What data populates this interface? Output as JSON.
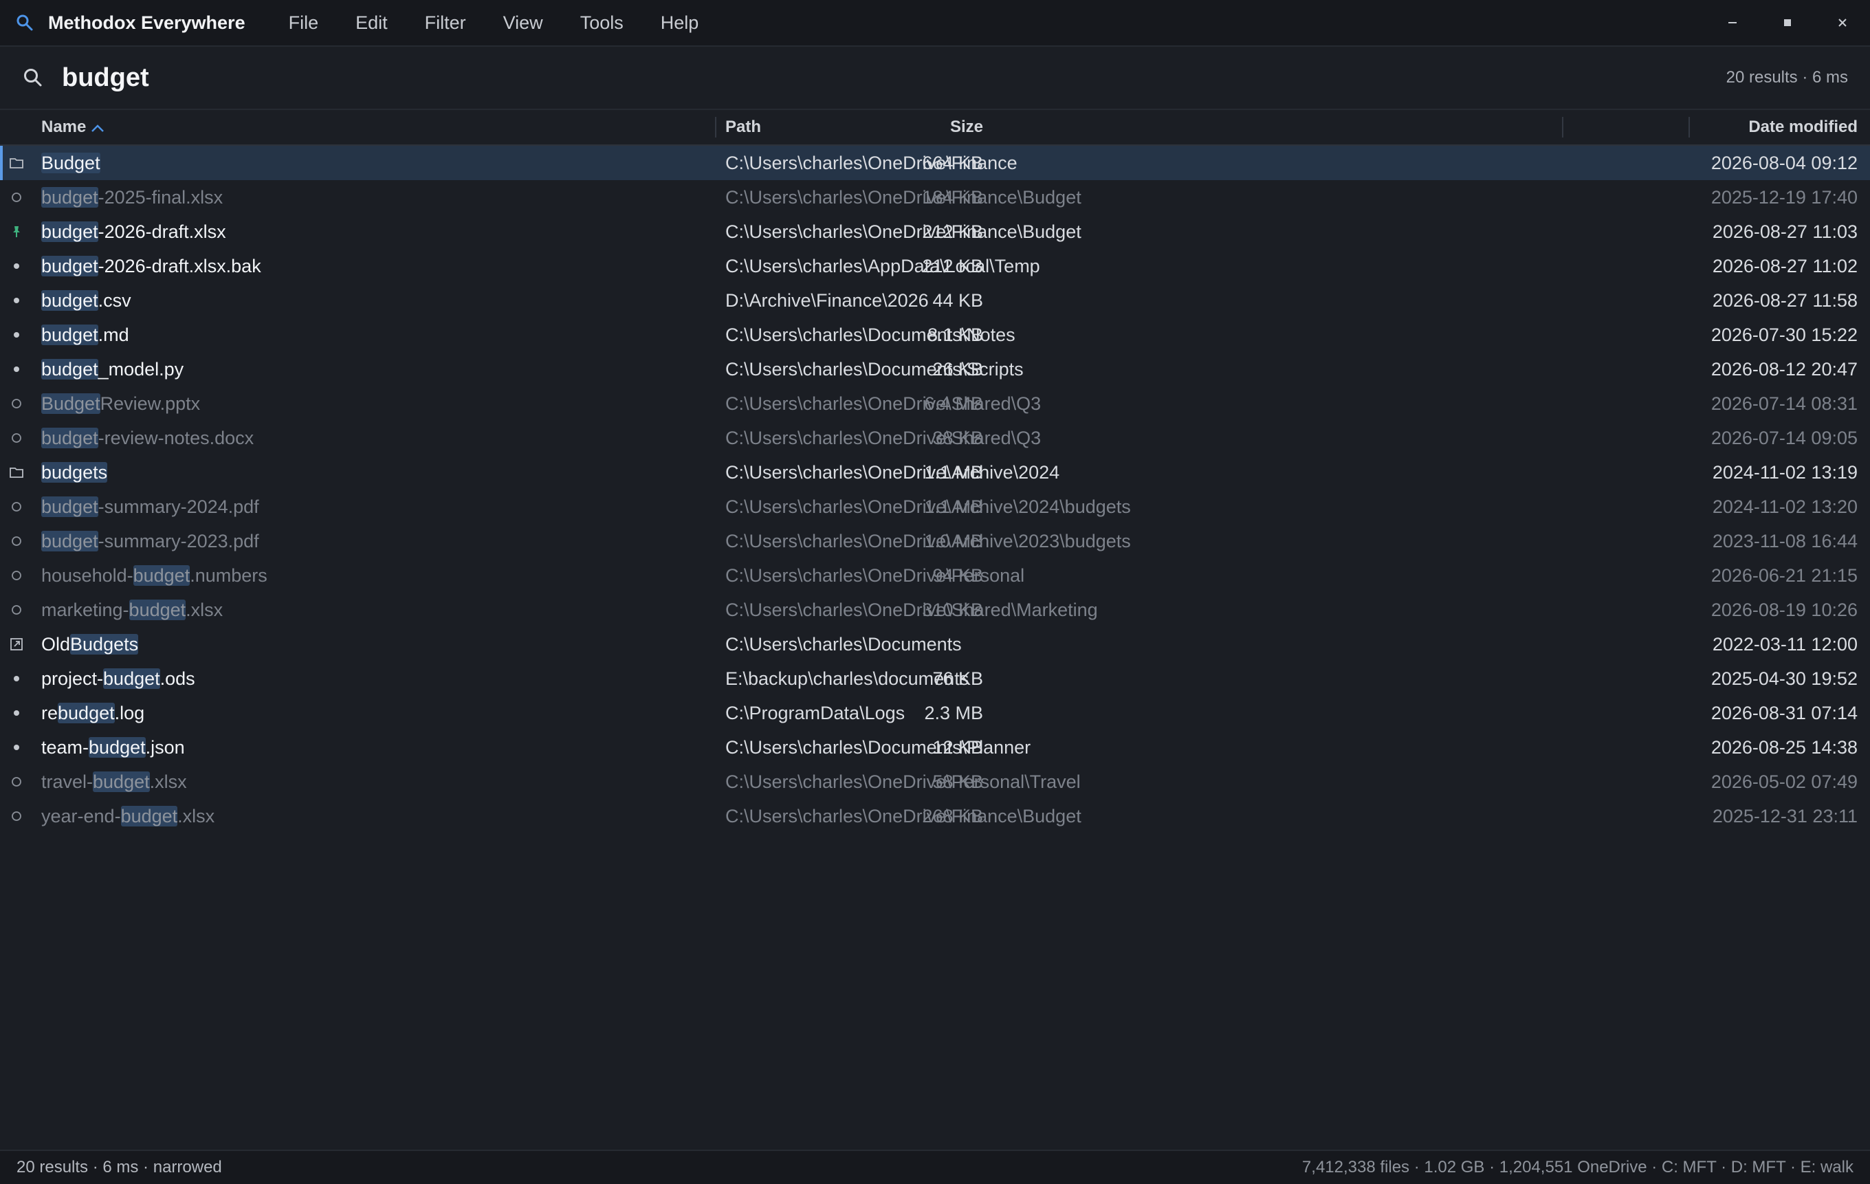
{
  "app": {
    "title": "Methodox Everywhere",
    "menu": [
      "File",
      "Edit",
      "Filter",
      "View",
      "Tools",
      "Help"
    ],
    "accent_color": "#4d94e8"
  },
  "search": {
    "query": "budget",
    "meta": "20 results · 6 ms"
  },
  "columns": {
    "name": "Name",
    "path": "Path",
    "size": "Size",
    "date": "Date modified"
  },
  "rows": [
    {
      "pre": "",
      "hl": "Budget",
      "post": "",
      "path": "C:\\Users\\charles\\OneDrive\\Finance",
      "size": "664 KB",
      "date": "2026-08-04 09:12",
      "icon": "folder-icon",
      "style": "bright",
      "selected": true
    },
    {
      "pre": "",
      "hl": "budget",
      "post": "-2025-final.xlsx",
      "path": "C:\\Users\\charles\\OneDrive\\Finance\\Budget",
      "size": "184 KB",
      "date": "2025-12-19 17:40",
      "icon": "cloud-file-icon",
      "style": "dim"
    },
    {
      "pre": "",
      "hl": "budget",
      "post": "-2026-draft.xlsx",
      "path": "C:\\Users\\charles\\OneDrive\\Finance\\Budget",
      "size": "212 KB",
      "date": "2026-08-27 11:03",
      "icon": "pin-icon",
      "style": "bright"
    },
    {
      "pre": "",
      "hl": "budget",
      "post": "-2026-draft.xlsx.bak",
      "path": "C:\\Users\\charles\\AppData\\Local\\Temp",
      "size": "212 KB",
      "date": "2026-08-27 11:02",
      "icon": "file-dot-icon",
      "style": "bright"
    },
    {
      "pre": "",
      "hl": "budget",
      "post": ".csv",
      "path": "D:\\Archive\\Finance\\2026",
      "size": "44 KB",
      "date": "2026-08-27 11:58",
      "icon": "file-dot-icon",
      "style": "bright"
    },
    {
      "pre": "",
      "hl": "budget",
      "post": ".md",
      "path": "C:\\Users\\charles\\Documents\\Notes",
      "size": "8.1 KB",
      "date": "2026-07-30 15:22",
      "icon": "file-dot-icon",
      "style": "bright"
    },
    {
      "pre": "",
      "hl": "budget",
      "post": "_model.py",
      "path": "C:\\Users\\charles\\Documents\\Scripts",
      "size": "26 KB",
      "date": "2026-08-12 20:47",
      "icon": "file-dot-icon",
      "style": "bright"
    },
    {
      "pre": "",
      "hl": "Budget",
      "post": "Review.pptx",
      "path": "C:\\Users\\charles\\OneDrive\\Shared\\Q3",
      "size": "6.4 MB",
      "date": "2026-07-14 08:31",
      "icon": "cloud-file-icon",
      "style": "dim"
    },
    {
      "pre": "",
      "hl": "budget",
      "post": "-review-notes.docx",
      "path": "C:\\Users\\charles\\OneDrive\\Shared\\Q3",
      "size": "38 KB",
      "date": "2026-07-14 09:05",
      "icon": "cloud-file-icon",
      "style": "dim"
    },
    {
      "pre": "",
      "hl": "budgets",
      "post": "",
      "path": "C:\\Users\\charles\\OneDrive\\Archive\\2024",
      "size": "1.1 MB",
      "date": "2024-11-02 13:19",
      "icon": "folder-icon",
      "style": "bright"
    },
    {
      "pre": "",
      "hl": "budget",
      "post": "-summary-2024.pdf",
      "path": "C:\\Users\\charles\\OneDrive\\Archive\\2024\\budgets",
      "size": "1.1 MB",
      "date": "2024-11-02 13:20",
      "icon": "cloud-file-icon",
      "style": "dim"
    },
    {
      "pre": "",
      "hl": "budget",
      "post": "-summary-2023.pdf",
      "path": "C:\\Users\\charles\\OneDrive\\Archive\\2023\\budgets",
      "size": "1.0 MB",
      "date": "2023-11-08 16:44",
      "icon": "cloud-file-icon",
      "style": "dim"
    },
    {
      "pre": "household-",
      "hl": "budget",
      "post": ".numbers",
      "path": "C:\\Users\\charles\\OneDrive\\Personal",
      "size": "94 KB",
      "date": "2026-06-21 21:15",
      "icon": "cloud-file-icon",
      "style": "dim"
    },
    {
      "pre": "marketing-",
      "hl": "budget",
      "post": ".xlsx",
      "path": "C:\\Users\\charles\\OneDrive\\Shared\\Marketing",
      "size": "310 KB",
      "date": "2026-08-19 10:26",
      "icon": "cloud-file-icon",
      "style": "dim"
    },
    {
      "pre": "Old",
      "hl": "Budgets",
      "post": "",
      "path": "C:\\Users\\charles\\Documents",
      "size": "",
      "date": "2022-03-11 12:00",
      "icon": "shortcut-icon",
      "style": "bright"
    },
    {
      "pre": "project-",
      "hl": "budget",
      "post": ".ods",
      "path": "E:\\backup\\charles\\documents",
      "size": "76 KB",
      "date": "2025-04-30 19:52",
      "icon": "file-dot-icon",
      "style": "bright"
    },
    {
      "pre": "re",
      "hl": "budget",
      "post": ".log",
      "path": "C:\\ProgramData\\Logs",
      "size": "2.3 MB",
      "date": "2026-08-31 07:14",
      "icon": "file-dot-icon",
      "style": "bright"
    },
    {
      "pre": "team-",
      "hl": "budget",
      "post": ".json",
      "path": "C:\\Users\\charles\\Documents\\Planner",
      "size": "12 KB",
      "date": "2026-08-25 14:38",
      "icon": "file-dot-icon",
      "style": "bright"
    },
    {
      "pre": "travel-",
      "hl": "budget",
      "post": ".xlsx",
      "path": "C:\\Users\\charles\\OneDrive\\Personal\\Travel",
      "size": "58 KB",
      "date": "2026-05-02 07:49",
      "icon": "cloud-file-icon",
      "style": "dim"
    },
    {
      "pre": "year-end-",
      "hl": "budget",
      "post": ".xlsx",
      "path": "C:\\Users\\charles\\OneDrive\\Finance\\Budget",
      "size": "268 KB",
      "date": "2025-12-31 23:11",
      "icon": "cloud-file-icon",
      "style": "dim"
    }
  ],
  "status": {
    "left": "20 results · 6 ms · narrowed",
    "right": "7,412,338 files · 1.02 GB · 1,204,551 OneDrive · C: MFT · D: MFT · E: walk"
  },
  "colors": {
    "selected_row": "#253447",
    "highlight": "#2e4460",
    "pin": "#3fb37f"
  }
}
